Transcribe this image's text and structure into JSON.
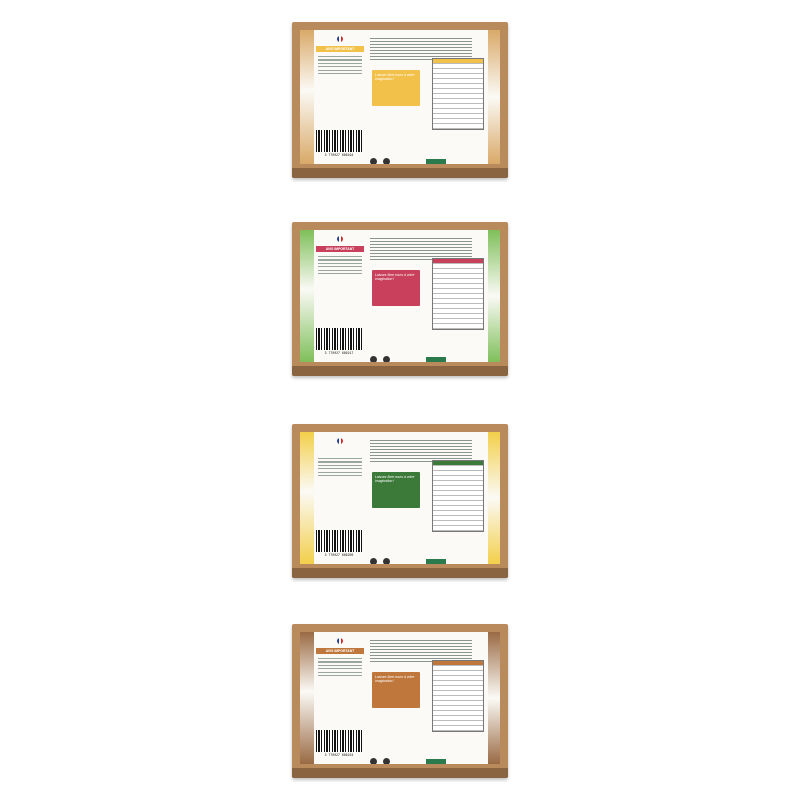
{
  "boxes": [
    {
      "name": "box-almond-vanilla",
      "accent": "#f2c14a",
      "deco": "#d9a968",
      "barcode": "3 770027 686194",
      "important": "AVIS IMPORTANT",
      "cta": "Laissez libre cours à votre imagination !"
    },
    {
      "name": "box-raspberry",
      "accent": "#c8405b",
      "deco": "#7fbf5a",
      "barcode": "3 770027 686217",
      "important": "AVIS IMPORTANT",
      "cta": "Laissez libre cours à votre imagination !"
    },
    {
      "name": "box-lemon",
      "accent": "#3c7a3a",
      "deco": "#f3cf4a",
      "barcode": "3 770027 686200",
      "important": "",
      "cta": "Laissez libre cours à votre imagination !"
    },
    {
      "name": "box-hazelnut-chocolate",
      "accent": "#c0773c",
      "deco": "#9a6a44",
      "barcode": "3 770027 686224",
      "important": "AVIS IMPORTANT",
      "cta": "Laissez libre cours à votre imagination !"
    }
  ]
}
